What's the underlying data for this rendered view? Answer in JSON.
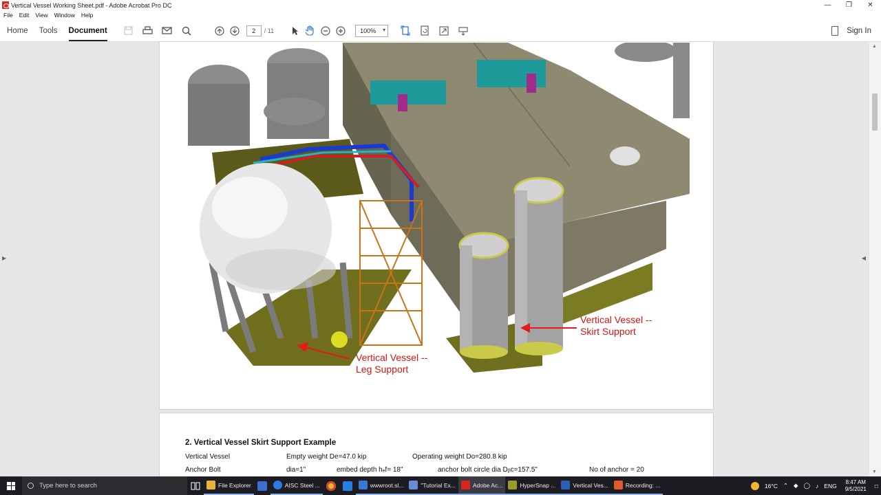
{
  "window": {
    "title": "Vertical Vessel Working Sheet.pdf - Adobe Acrobat Pro DC"
  },
  "menu": [
    "File",
    "Edit",
    "View",
    "Window",
    "Help"
  ],
  "toolbar": {
    "tabs": [
      "Home",
      "Tools",
      "Document"
    ],
    "page_current": "2",
    "page_total": "/ 11",
    "zoom": "100%",
    "sign_in": "Sign In"
  },
  "document": {
    "annotations": {
      "leg": "Vertical Vessel --\nLeg Support",
      "skirt": "Vertical Vessel --\nSkirt Support"
    },
    "section_heading": "2. Vertical Vessel Skirt Support Example",
    "rows": [
      {
        "c1": "Vertical Vessel",
        "c2": "Empty weight De=47.0 kip",
        "c3": "Operating weight Do=280.8 kip",
        "c4": "",
        "c5": ""
      },
      {
        "c1": "Anchor Bolt",
        "c2": "dia=1”",
        "c3": "embed depth hₑf= 18”",
        "c4": "anchor bolt circle dia  Dᵦc=157.5”",
        "c5": "No of anchor = 20"
      }
    ]
  },
  "taskbar": {
    "search_placeholder": "Type here to search",
    "tasks": [
      {
        "label": "File Explorer",
        "color": "#e8b33c"
      },
      {
        "label": "AISC Steel ...",
        "color": "#2a7de1"
      },
      {
        "label": "wwwroot.sl...",
        "color": "#3b78d4"
      },
      {
        "label": "\"Tutorial Ex...",
        "color": "#6b8bd6"
      },
      {
        "label": "Adobe Ac...",
        "color": "#d9261c"
      },
      {
        "label": "HyperSnap ...",
        "color": "#9b9b2b"
      },
      {
        "label": "Vertical Ves...",
        "color": "#2b5fb4"
      },
      {
        "label": "Recording: ...",
        "color": "#e05a2b"
      }
    ],
    "weather": "16°C",
    "lang": "ENG",
    "time": "8:47 AM",
    "date": "9/5/2021"
  }
}
